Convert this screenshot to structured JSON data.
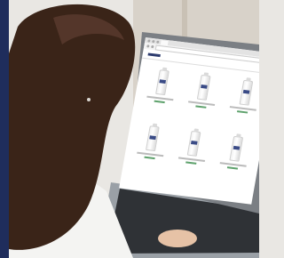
{
  "scene": {
    "subject": "woman-using-laptop",
    "palette": {
      "frame_blue": "#1f2d5c",
      "hair": "#3a2418",
      "skin": "#e6c2a6",
      "shirt": "#f4f4f2",
      "laptop": "#8d9197",
      "keyboard": "#2f3236",
      "background": "#e9e7e3"
    }
  },
  "screen": {
    "product_count": 6
  }
}
